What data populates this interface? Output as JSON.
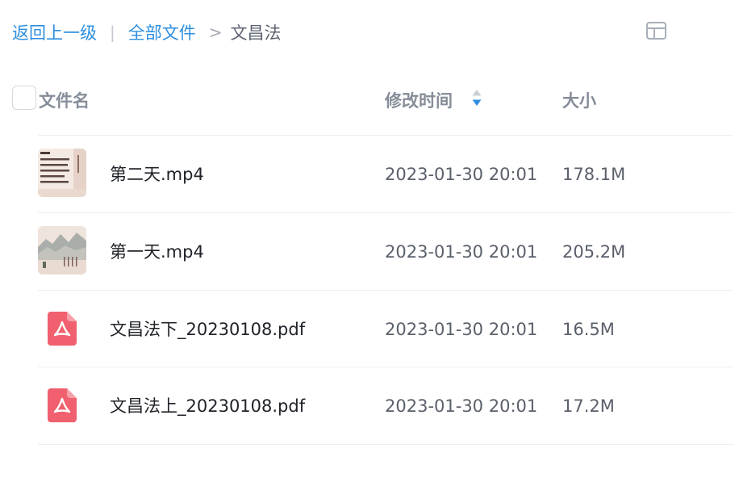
{
  "breadcrumb": {
    "back": "返回上一级",
    "separator": "|",
    "all_files": "全部文件",
    "arrow": ">",
    "current": "文昌法"
  },
  "table": {
    "columns": {
      "name": "文件名",
      "modified": "修改时间",
      "size": "大小"
    },
    "sort": {
      "column": "modified",
      "direction": "desc"
    }
  },
  "files": [
    {
      "name": "第二天.mp4",
      "modified": "2023-01-30 20:01",
      "size": "178.1M",
      "icon": "video-thumbnail-text"
    },
    {
      "name": "第一天.mp4",
      "modified": "2023-01-30 20:01",
      "size": "205.2M",
      "icon": "video-thumbnail-landscape"
    },
    {
      "name": "文昌法下_20230108.pdf",
      "modified": "2023-01-30 20:01",
      "size": "16.5M",
      "icon": "pdf-icon"
    },
    {
      "name": "文昌法上_20230108.pdf",
      "modified": "2023-01-30 20:01",
      "size": "17.2M",
      "icon": "pdf-icon"
    }
  ],
  "colors": {
    "link": "#2e8fe0",
    "pdf_red": "#f0606e",
    "sort_active": "#2e8fe0"
  }
}
